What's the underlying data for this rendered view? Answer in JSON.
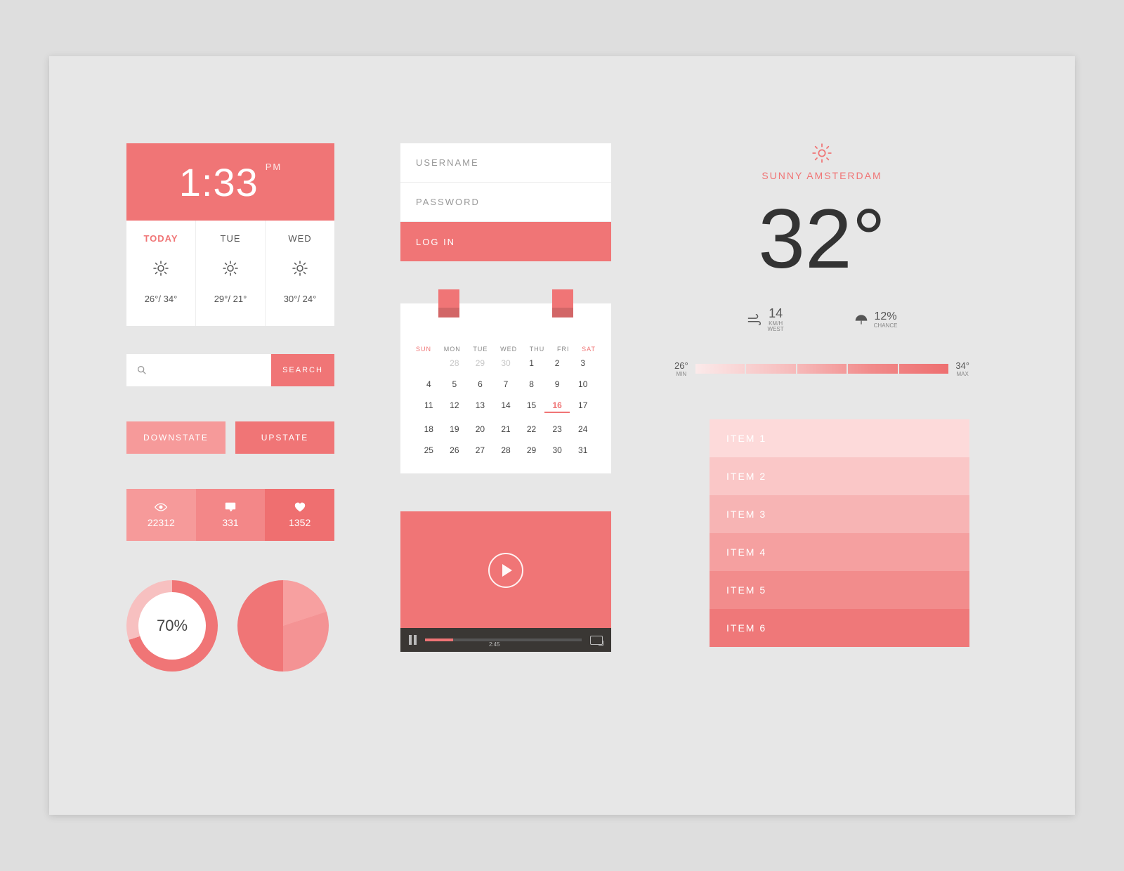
{
  "clock": {
    "time": "1:33",
    "ampm": "PM"
  },
  "forecast": [
    {
      "label": "TODAY",
      "lo": "26°",
      "hi": "34°"
    },
    {
      "label": "TUE",
      "lo": "29°",
      "hi": "21°"
    },
    {
      "label": "WED",
      "lo": "30°",
      "hi": "24°"
    }
  ],
  "search": {
    "button": "SEARCH"
  },
  "buttons": {
    "down": "DOWNSTATE",
    "up": "UPSTATE"
  },
  "stats": {
    "views": "22312",
    "comments": "331",
    "likes": "1352"
  },
  "gauge": {
    "percent": "70%"
  },
  "login": {
    "user_ph": "USERNAME",
    "pass_ph": "PASSWORD",
    "go": "LOG IN"
  },
  "calendar": {
    "dow": [
      "SUN",
      "MON",
      "TUE",
      "WED",
      "THU",
      "FRI",
      "SAT"
    ],
    "weeks": [
      [
        "28",
        "29",
        "30",
        "1",
        "2",
        "3"
      ],
      [
        "4",
        "5",
        "6",
        "7",
        "8",
        "9",
        "10"
      ],
      [
        "11",
        "12",
        "13",
        "14",
        "15",
        "16",
        "17"
      ],
      [
        "18",
        "19",
        "20",
        "21",
        "22",
        "23",
        "24"
      ],
      [
        "25",
        "26",
        "27",
        "28",
        "29",
        "30",
        "31"
      ]
    ],
    "selected": "16",
    "off": [
      "28",
      "29",
      "30"
    ]
  },
  "video": {
    "elapsed": "2:45"
  },
  "weather": {
    "title": "SUNNY AMSTERDAM",
    "temp": "32°",
    "wind_val": "14",
    "wind_unit": "KM/H",
    "wind_dir": "WEST",
    "rain_val": "12%",
    "rain_label": "CHANCE",
    "min": "26°",
    "min_lbl": "MIN",
    "max": "34°",
    "max_lbl": "MAX"
  },
  "items": [
    "ITEM 1",
    "ITEM 2",
    "ITEM 3",
    "ITEM 4",
    "ITEM 5",
    "ITEM 6"
  ]
}
